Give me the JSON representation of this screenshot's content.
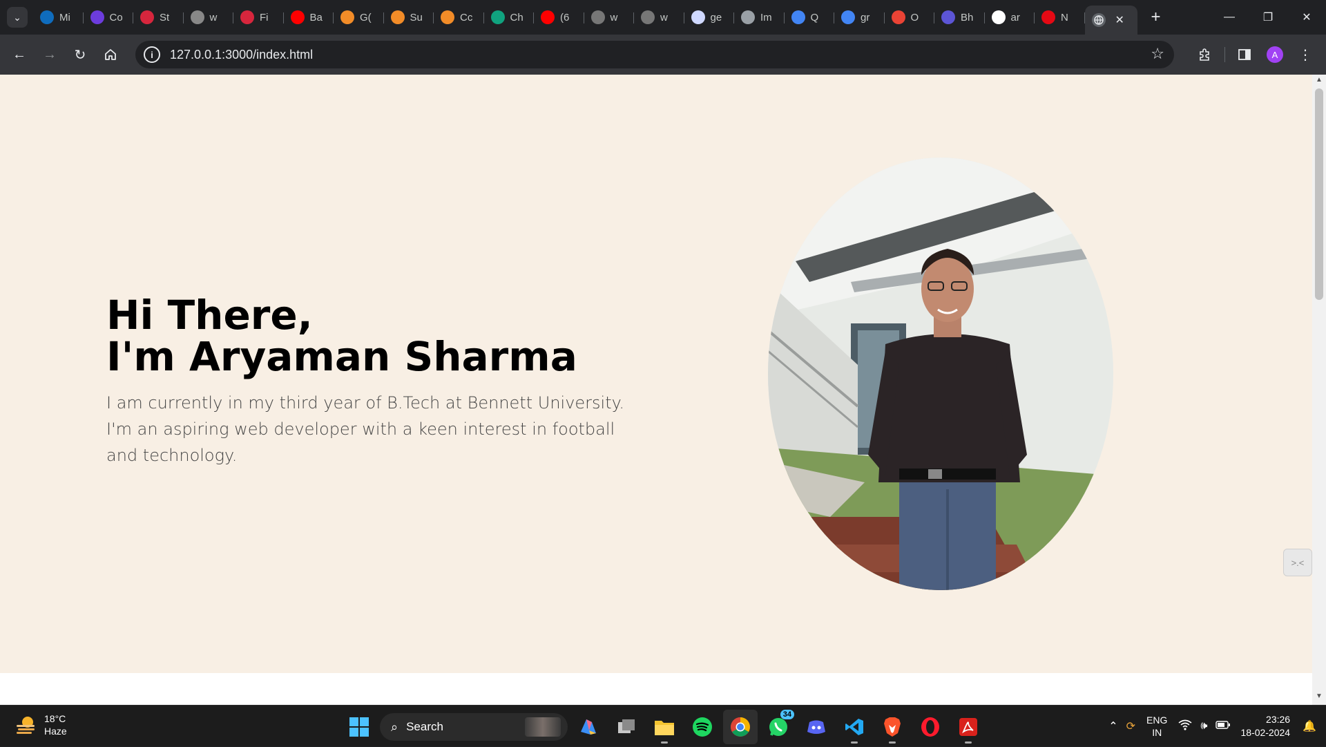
{
  "browser": {
    "tabs": [
      {
        "label": "Mi",
        "icon": "outlook-icon",
        "color": "#0f6cbd"
      },
      {
        "label": "Co",
        "icon": "purple-u-icon",
        "color": "#6c3cdd"
      },
      {
        "label": "St",
        "icon": "tuf-icon",
        "color": "#d7263d"
      },
      {
        "label": "w",
        "icon": "cc-icon",
        "color": "#888888"
      },
      {
        "label": "Fi",
        "icon": "tuf-icon",
        "color": "#d7263d"
      },
      {
        "label": "Ba",
        "icon": "youtube-icon",
        "color": "#ff0000"
      },
      {
        "label": "G(",
        "icon": "cc-orange-icon",
        "color": "#f28c28"
      },
      {
        "label": "Su",
        "icon": "cc-orange-icon",
        "color": "#f28c28"
      },
      {
        "label": "Cc",
        "icon": "cc-orange-icon",
        "color": "#f28c28"
      },
      {
        "label": "Ch",
        "icon": "chatgpt-icon",
        "color": "#10a37f"
      },
      {
        "label": "(6",
        "icon": "youtube-icon",
        "color": "#ff0000"
      },
      {
        "label": "w",
        "icon": "c-icon",
        "color": "#777777"
      },
      {
        "label": "w",
        "icon": "c-icon",
        "color": "#777777"
      },
      {
        "label": "ge",
        "icon": "gemini-icon",
        "color": "#cfd8ff"
      },
      {
        "label": "Im",
        "icon": "globe-icon",
        "color": "#9aa0a6"
      },
      {
        "label": "Q",
        "icon": "google-icon",
        "color": "#4285f4"
      },
      {
        "label": "gr",
        "icon": "google-icon",
        "color": "#4285f4"
      },
      {
        "label": "O",
        "icon": "gmail-icon",
        "color": "#ea4335"
      },
      {
        "label": "Bh",
        "icon": "list-icon",
        "color": "#5c55d6"
      },
      {
        "label": "ar",
        "icon": "github-icon",
        "color": "#ffffff"
      },
      {
        "label": "N",
        "icon": "netflix-icon",
        "color": "#e50914"
      }
    ],
    "active_tab": {
      "icon": "globe-icon"
    },
    "url": "127.0.0.1:3000/index.html",
    "avatar_letter": "A"
  },
  "hero": {
    "title_line1": "Hi There,",
    "title_line2": "I'm Aryaman Sharma",
    "description": "I am currently in my third year of B.Tech at Bennett University. I'm an aspiring web developer with a keen interest in football and technology."
  },
  "taskbar": {
    "weather": {
      "temp": "18°C",
      "condition": "Haze"
    },
    "search_label": "Search",
    "whatsapp_badge": "34",
    "language": {
      "line1": "ENG",
      "line2": "IN"
    },
    "clock": {
      "time": "23:26",
      "date": "18-02-2024"
    }
  }
}
